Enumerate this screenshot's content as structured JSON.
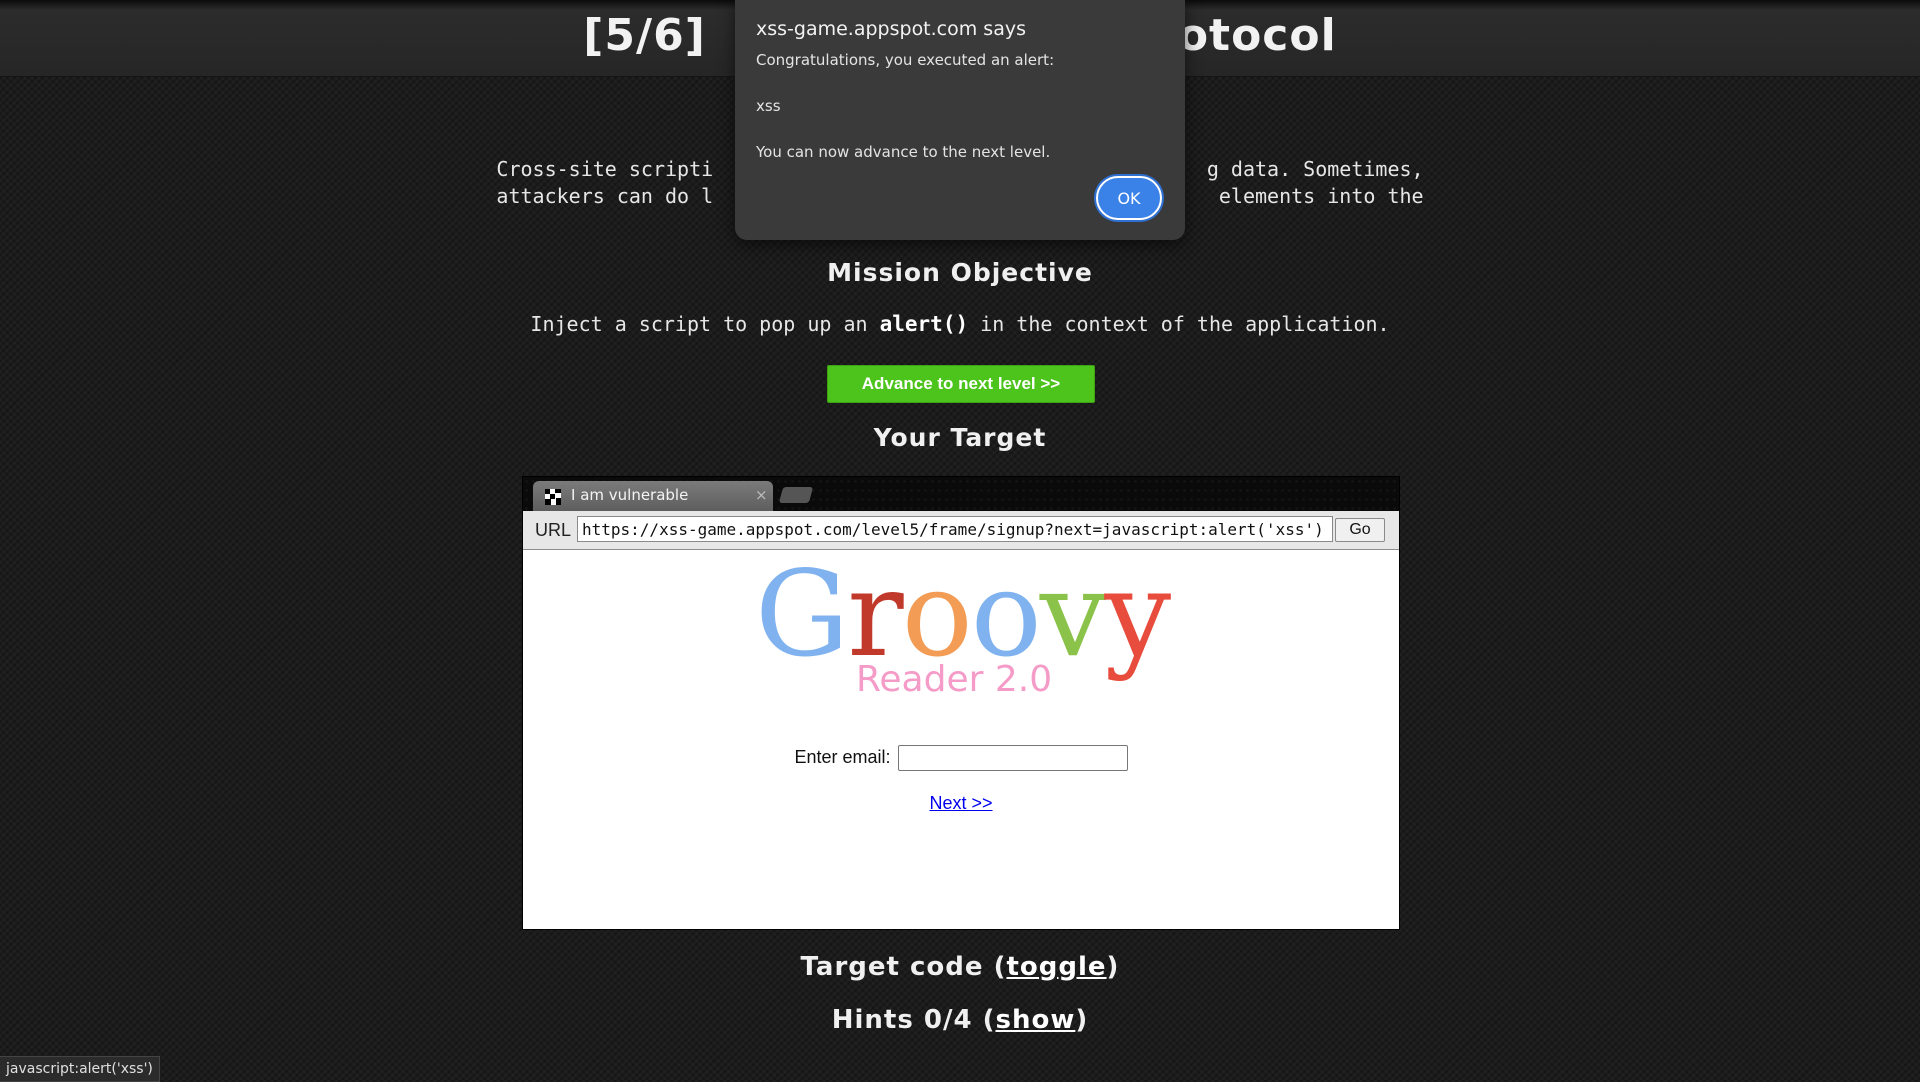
{
  "header": {
    "level": "[5/6]",
    "title_tail": "otocol"
  },
  "intro": {
    "line1": "Cross-site scripti                                         g data. Sometimes,",
    "line2": "attackers can do l                                          elements into the"
  },
  "mission": {
    "heading": "Mission Objective",
    "text_before": "Inject a script to pop up an",
    "text_code": "alert()",
    "text_after": "in the context of the application."
  },
  "advance_button": "Advance to next level >>",
  "target_heading": "Your Target",
  "browser": {
    "tab_title": "I am vulnerable",
    "tab_close": "×",
    "url_label": "URL",
    "url_value": "https://xss-game.appspot.com/level5/frame/signup?next=javascript:alert('xss')",
    "go_label": "Go",
    "logo": {
      "letters": [
        {
          "ch": "G",
          "color": "#7fb2ee"
        },
        {
          "ch": "r",
          "color": "#c0392b"
        },
        {
          "ch": "o",
          "color": "#f39c56"
        },
        {
          "ch": "o",
          "color": "#7fb2ee"
        },
        {
          "ch": "v",
          "color": "#8bc34a"
        },
        {
          "ch": "y",
          "color": "#e74c3c"
        }
      ],
      "subtitle": "Reader 2.0"
    },
    "email_label": "Enter email:",
    "email_value": "",
    "next_link": "Next >>"
  },
  "target_code": {
    "label": "Target code (",
    "link": "toggle",
    "close": ")"
  },
  "hints": {
    "label": "Hints 0/4 (",
    "link": "show",
    "close": ")"
  },
  "dialog": {
    "title": "xss-game.appspot.com says",
    "line1": "Congratulations, you executed an alert:",
    "line2": "xss",
    "line3": "You can now advance to the next level.",
    "ok": "OK"
  },
  "status_bar": "javascript:alert('xss')"
}
